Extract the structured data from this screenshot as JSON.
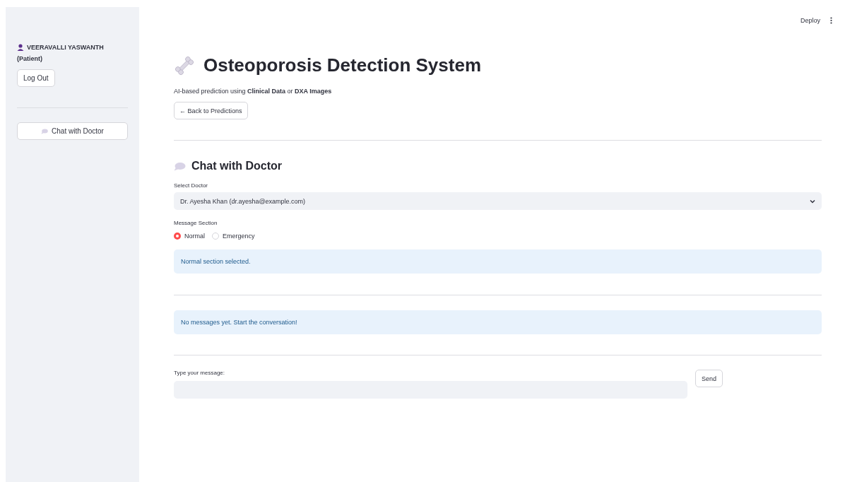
{
  "header": {
    "deploy_button": "Deploy"
  },
  "sidebar": {
    "user_name": "VEERAVALLI YASWANTH",
    "role": "(Patient)",
    "logout_button": "Log Out",
    "nav_button": "Chat with Doctor"
  },
  "main": {
    "title": "Osteoporosis Detection System",
    "subtitle": "AI-based prediction using **Clinical Data** or **DXA Images**",
    "back_button": "← Back to Predictions",
    "chat_heading": "Chat with Doctor",
    "doctor_select": {
      "label": "Select Doctor",
      "value": "Dr. Ayesha Khan (dr.ayesha@example.com)"
    },
    "message_section": {
      "label": "Message Section",
      "options": [
        {
          "label": "Normal",
          "selected": true
        },
        {
          "label": "Emergency",
          "selected": false
        }
      ]
    },
    "section_notice": "Normal section selected.",
    "messages_notice": "No messages yet. Start the conversation!",
    "message_input": {
      "label": "Type your message:"
    },
    "send_button": "Send"
  }
}
